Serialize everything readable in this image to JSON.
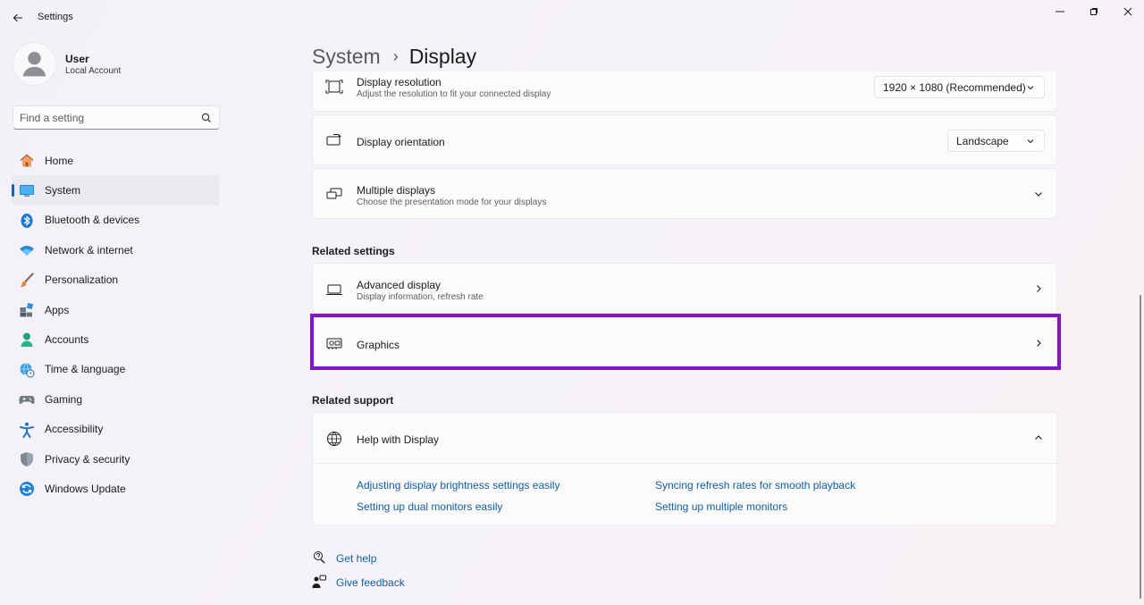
{
  "app": {
    "title": "Settings"
  },
  "user": {
    "name": "User",
    "account": "Local Account"
  },
  "search": {
    "placeholder": "Find a setting",
    "value": ""
  },
  "nav": {
    "items": [
      {
        "label": "Home",
        "icon": "home-icon"
      },
      {
        "label": "System",
        "icon": "system-icon",
        "active": true
      },
      {
        "label": "Bluetooth & devices",
        "icon": "bluetooth-icon"
      },
      {
        "label": "Network & internet",
        "icon": "wifi-icon"
      },
      {
        "label": "Personalization",
        "icon": "brush-icon"
      },
      {
        "label": "Apps",
        "icon": "apps-icon"
      },
      {
        "label": "Accounts",
        "icon": "accounts-icon"
      },
      {
        "label": "Time & language",
        "icon": "globe-clock-icon"
      },
      {
        "label": "Gaming",
        "icon": "gamepad-icon"
      },
      {
        "label": "Accessibility",
        "icon": "accessibility-icon"
      },
      {
        "label": "Privacy & security",
        "icon": "shield-icon"
      },
      {
        "label": "Windows Update",
        "icon": "update-icon"
      }
    ]
  },
  "breadcrumb": {
    "parent": "System",
    "separator": "›",
    "current": "Display"
  },
  "display_settings": {
    "resolution": {
      "title": "Display resolution",
      "subtitle": "Adjust the resolution to fit your connected display",
      "value": "1920 × 1080 (Recommended)"
    },
    "orientation": {
      "title": "Display orientation",
      "value": "Landscape"
    },
    "multiple": {
      "title": "Multiple displays",
      "subtitle": "Choose the presentation mode for your displays"
    }
  },
  "related_settings": {
    "title": "Related settings",
    "advanced": {
      "title": "Advanced display",
      "subtitle": "Display information, refresh rate"
    },
    "graphics": {
      "title": "Graphics"
    }
  },
  "related_support": {
    "title": "Related support",
    "help": {
      "title": "Help with Display"
    },
    "links": [
      "Adjusting display brightness settings easily",
      "Syncing refresh rates for smooth playback",
      "Setting up dual monitors easily",
      "Setting up multiple monitors"
    ]
  },
  "footer": {
    "get_help": "Get help",
    "give_feedback": "Give feedback"
  },
  "colors": {
    "accent": "#0067c0",
    "link": "#115ea3",
    "highlight": "#7e17c7"
  }
}
